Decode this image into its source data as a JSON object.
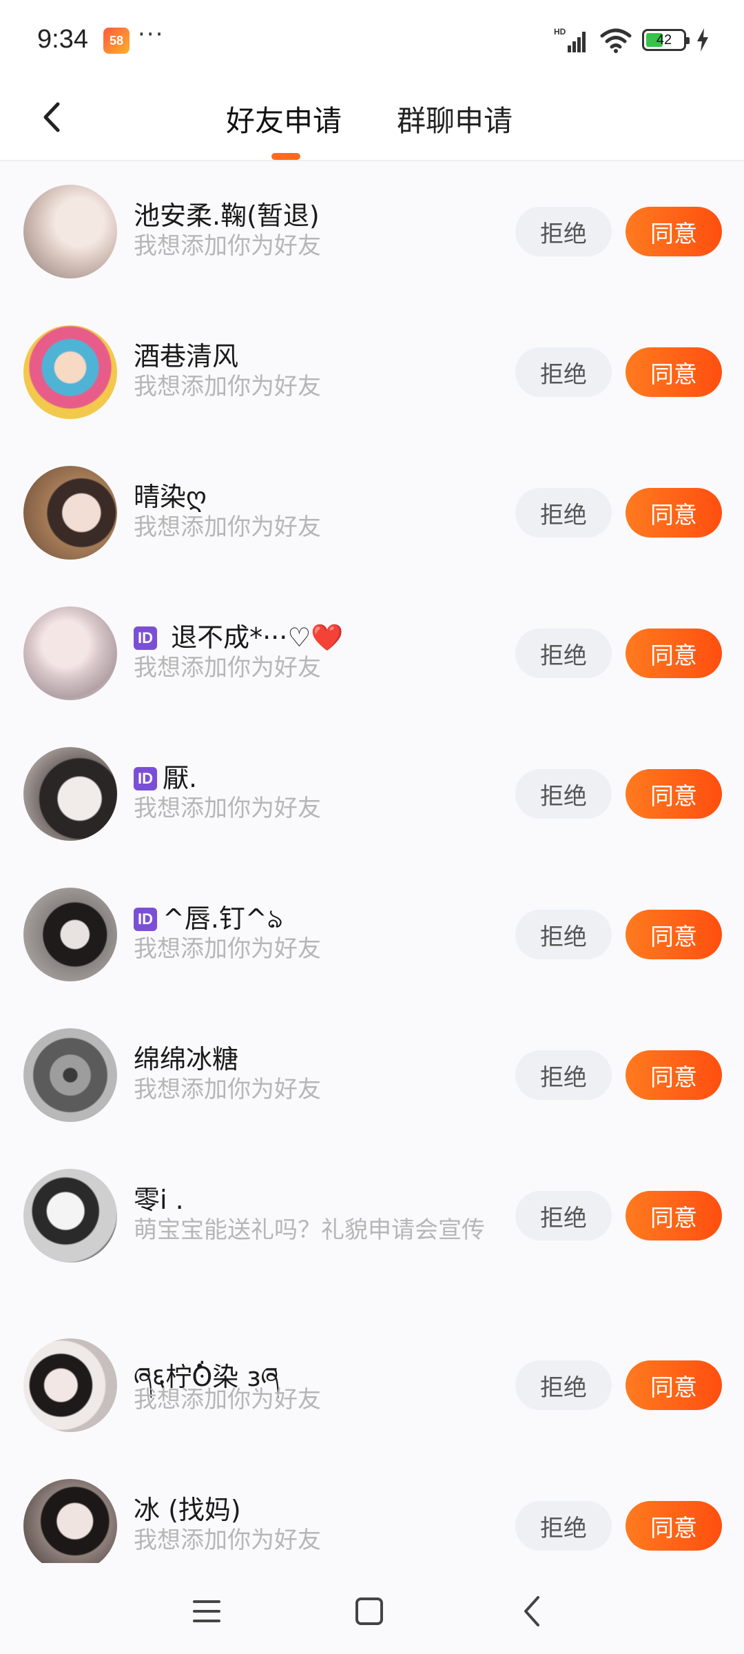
{
  "status_bar": {
    "time": "9:34",
    "app_icon_text": "58",
    "more": "···",
    "battery_percent": "42",
    "battery_level": 0.42
  },
  "header": {
    "tabs": [
      {
        "label": "好友申请",
        "active": true
      },
      {
        "label": "群聊申请",
        "active": false
      }
    ],
    "accent_color": "#ff6a1f"
  },
  "buttons": {
    "reject": "拒绝",
    "accept": "同意"
  },
  "requests": [
    {
      "name": "池安柔.鞠(暂退)",
      "id_badge": false,
      "message": "我想添加你为好友"
    },
    {
      "name": "酒巷清风",
      "id_badge": false,
      "message": "我想添加你为好友"
    },
    {
      "name": "晴染ღ",
      "id_badge": false,
      "message": "我想添加你为好友"
    },
    {
      "name": " 退不成*···♡❤️",
      "id_badge": true,
      "message": "我想添加你为好友"
    },
    {
      "name": "厭.",
      "id_badge": true,
      "message": "我想添加你为好友"
    },
    {
      "name": "^唇.钉^ঌ",
      "id_badge": true,
      "message": "我想添加你为好友"
    },
    {
      "name": "绵绵冰糖",
      "id_badge": false,
      "message": "我想添加你为好友"
    },
    {
      "name": "零i .",
      "id_badge": false,
      "message": "萌宝宝能送礼吗？礼貌申请会宣传"
    },
    {
      "name": "ཞ६柠̇ʘ̇染 ɜཞ",
      "id_badge": false,
      "message": "我想添加你为好友"
    },
    {
      "name": "冰 (找妈)",
      "id_badge": false,
      "message": "我想添加你为好友"
    }
  ],
  "id_badge_text": "ID"
}
